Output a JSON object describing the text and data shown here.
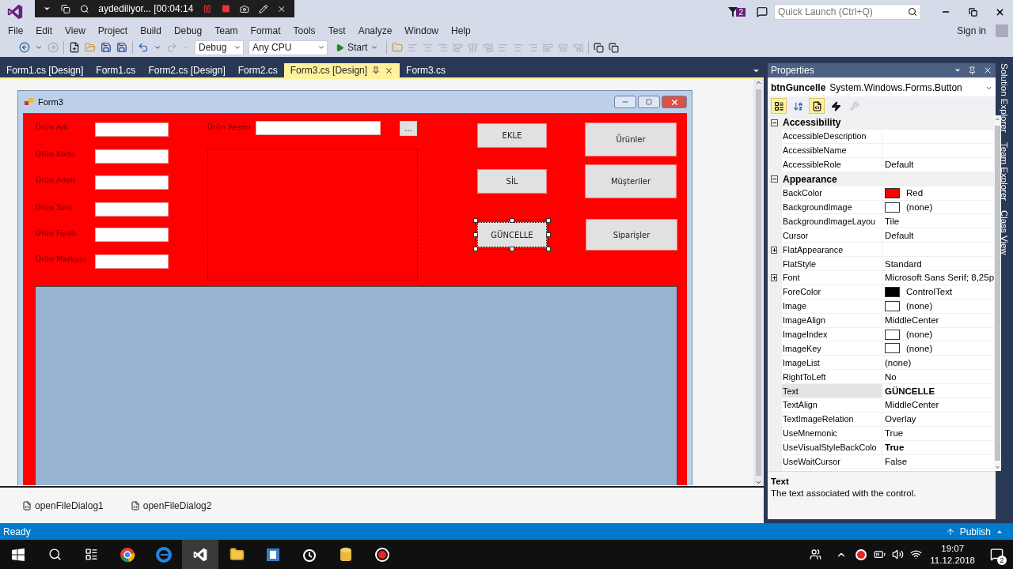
{
  "recorder": {
    "title": "aydediliyor... [00:04:14"
  },
  "notifications": {
    "count": "2"
  },
  "quick_launch": {
    "placeholder": "Quick Launch (Ctrl+Q)"
  },
  "menu": [
    "File",
    "Edit",
    "View",
    "Project",
    "Build",
    "Debug",
    "Team",
    "Format",
    "Tools",
    "Test",
    "Analyze",
    "Window",
    "Help"
  ],
  "sign_in": "Sign in",
  "toolbar": {
    "configuration": "Debug",
    "platform": "Any CPU",
    "start": "Start"
  },
  "tabs": [
    {
      "label": "Form1.cs [Design]",
      "selected": false
    },
    {
      "label": "Form1.cs",
      "selected": false
    },
    {
      "label": "Form2.cs [Design]",
      "selected": false
    },
    {
      "label": "Form2.cs",
      "selected": false
    },
    {
      "label": "Form3.cs [Design]",
      "selected": true
    },
    {
      "label": "Form3.cs",
      "selected": false
    }
  ],
  "form": {
    "title": "Form3",
    "fields": [
      "Ürün Adı",
      "Ürün Kodu",
      "Ürün Adeti",
      "Ürün Türü",
      "Ürün Fiyatı",
      "Ürün Markası"
    ],
    "image_label": "Ürün Resmi",
    "browse": "...",
    "actions": [
      {
        "label": "EKLE",
        "selected": false
      },
      {
        "label": "SİL",
        "selected": false
      },
      {
        "label": "GÜNCELLE",
        "selected": true
      }
    ],
    "navigation": [
      {
        "label": "Ürünler",
        "selected": false
      },
      {
        "label": "Müşteriler",
        "selected": false
      },
      {
        "label": "Siparişler",
        "selected": false
      }
    ]
  },
  "component_tray": [
    "openFileDialog1",
    "openFileDialog2"
  ],
  "properties": {
    "title": "Properties",
    "object_name": "btnGuncelle",
    "object_type": "System.Windows.Forms.Button",
    "categories": [
      {
        "name": "Accessibility",
        "expanded": true,
        "rows": [
          {
            "name": "AccessibleDescription",
            "value": "",
            "selected": false
          },
          {
            "name": "AccessibleName",
            "value": "",
            "selected": false
          },
          {
            "name": "AccessibleRole",
            "value": "Default",
            "selected": false
          }
        ]
      },
      {
        "name": "Appearance",
        "expanded": true,
        "rows": [
          {
            "name": "BackColor",
            "value": "Red",
            "color": "#ff0000",
            "selected": false
          },
          {
            "name": "BackgroundImage",
            "value": "(none)",
            "color": "#ffffff",
            "selected": false
          },
          {
            "name": "BackgroundImageLayou",
            "value": "Tile",
            "selected": false
          },
          {
            "name": "Cursor",
            "value": "Default",
            "selected": false
          },
          {
            "name": "FlatAppearance",
            "value": "",
            "expandable": true,
            "selected": false
          },
          {
            "name": "FlatStyle",
            "value": "Standard",
            "selected": false
          },
          {
            "name": "Font",
            "value": "Microsoft Sans Serif; 8,25p",
            "expandable": true,
            "selected": false
          },
          {
            "name": "ForeColor",
            "value": "ControlText",
            "color": "#000000",
            "selected": false
          },
          {
            "name": "Image",
            "value": "(none)",
            "color": "#ffffff",
            "selected": false
          },
          {
            "name": "ImageAlign",
            "value": "MiddleCenter",
            "selected": false
          },
          {
            "name": "ImageIndex",
            "value": "(none)",
            "color": "#ffffff",
            "selected": false
          },
          {
            "name": "ImageKey",
            "value": "(none)",
            "color": "#ffffff",
            "selected": false
          },
          {
            "name": "ImageList",
            "value": "(none)",
            "selected": false
          },
          {
            "name": "RightToLeft",
            "value": "No",
            "selected": false
          },
          {
            "name": "Text",
            "value": "GÜNCELLE",
            "modified": true,
            "selected": true
          },
          {
            "name": "TextAlign",
            "value": "MiddleCenter",
            "selected": false
          },
          {
            "name": "TextImageRelation",
            "value": "Overlay",
            "selected": false
          },
          {
            "name": "UseMnemonic",
            "value": "True",
            "selected": false
          },
          {
            "name": "UseVisualStyleBackColo",
            "value": "True",
            "modified": true,
            "selected": false
          },
          {
            "name": "UseWaitCursor",
            "value": "False",
            "selected": false
          }
        ]
      }
    ],
    "description": {
      "title": "Text",
      "text": "The text associated with the control."
    }
  },
  "side_tabs": [
    "Solution Explorer",
    "Team Explorer",
    "Class View"
  ],
  "status": {
    "text": "Ready",
    "publish": "Publish"
  },
  "taskbar": {
    "time": "19:07",
    "date": "11.12.2018",
    "notifications": "2"
  }
}
